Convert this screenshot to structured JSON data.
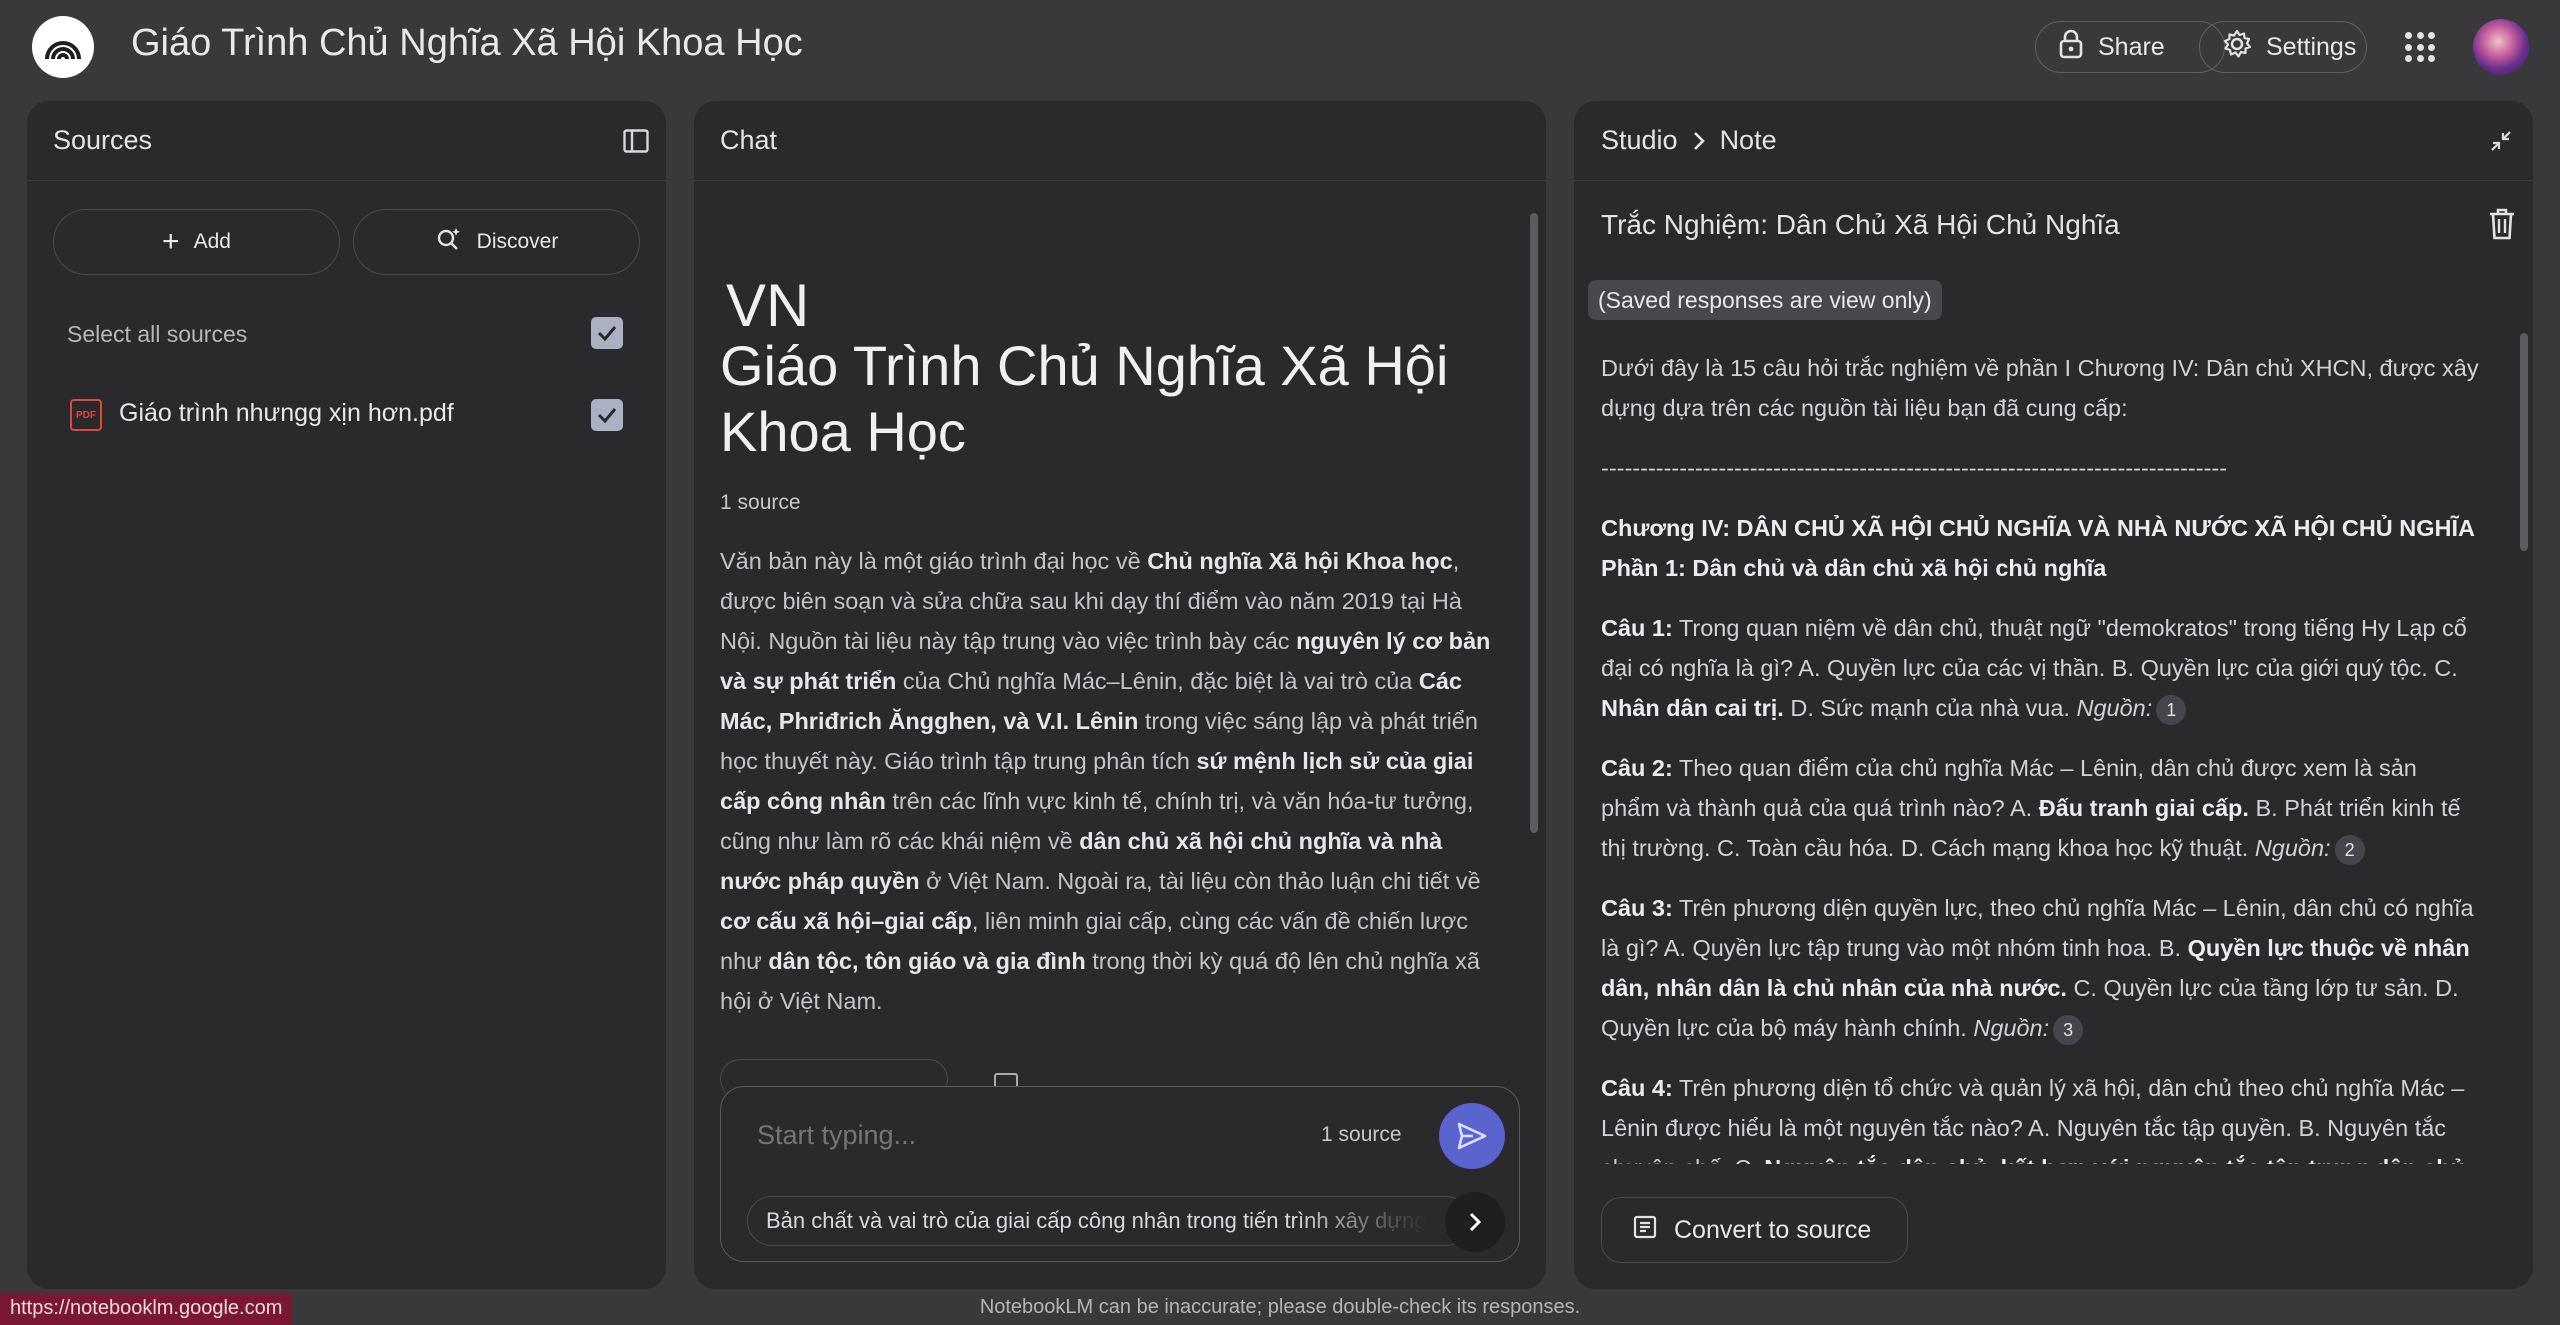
{
  "app": {
    "title": "Giáo Trình Chủ Nghĩa Xã Hội Khoa Học",
    "logo_icon": "notebooklm-logo-icon"
  },
  "header": {
    "share_label": "Share",
    "share_icon": "lock-icon",
    "settings_label": "Settings",
    "settings_icon": "gear-icon",
    "apps_icon": "apps-grid-icon",
    "avatar_icon": "user-avatar"
  },
  "sources": {
    "title": "Sources",
    "collapse_icon": "panel-collapse-icon",
    "add_label": "Add",
    "discover_label": "Discover",
    "select_all_label": "Select all sources",
    "items": [
      {
        "name": "Giáo trình nhưngg xịn hơn.pdf",
        "icon": "pdf-icon",
        "checked": true
      }
    ]
  },
  "chat": {
    "title": "Chat",
    "emoji_tag": "VN",
    "notebook_title": "Giáo Trình Chủ Nghĩa Xã Hội Khoa Học",
    "source_count": "1 source",
    "summary_segments": [
      {
        "t": "Văn bản này là một giáo trình đại học về ",
        "b": false
      },
      {
        "t": "Chủ nghĩa Xã hội Khoa học",
        "b": true
      },
      {
        "t": ", được biên soạn và sửa chữa sau khi dạy thí điểm vào năm 2019 tại Hà Nội. Nguồn tài liệu này tập trung vào việc trình bày các ",
        "b": false
      },
      {
        "t": "nguyên lý cơ bản và sự phát triển",
        "b": true
      },
      {
        "t": " của Chủ nghĩa Mác–Lênin, đặc biệt là vai trò của ",
        "b": false
      },
      {
        "t": "Các Mác, Phriđrich Ăngghen, và V.I. Lênin",
        "b": true
      },
      {
        "t": " trong việc sáng lập và phát triển học thuyết này. Giáo trình tập trung phân tích ",
        "b": false
      },
      {
        "t": "sứ mệnh lịch sử của giai cấp công nhân",
        "b": true
      },
      {
        "t": " trên các lĩnh vực kinh tế, chính trị, và văn hóa-tư tưởng, cũng như làm rõ các khái niệm về ",
        "b": false
      },
      {
        "t": "dân chủ xã hội chủ nghĩa và nhà nước pháp quyền",
        "b": true
      },
      {
        "t": " ở Việt Nam. Ngoài ra, tài liệu còn thảo luận chi tiết về ",
        "b": false
      },
      {
        "t": "cơ cấu xã hội–giai cấp",
        "b": true
      },
      {
        "t": ", liên minh giai cấp, cùng các vấn đề chiến lược như ",
        "b": false
      },
      {
        "t": "dân tộc, tôn giáo và gia đình",
        "b": true
      },
      {
        "t": " trong thời kỳ quá độ lên chủ nghĩa xã hội ở Việt Nam.",
        "b": false
      }
    ],
    "input_placeholder": "Start typing...",
    "input_source_count": "1 source",
    "suggestion": "Bản chất và vai trò của giai cấp công nhân trong tiến trình xây dựng"
  },
  "studio": {
    "breadcrumb_root": "Studio",
    "breadcrumb_current": "Note",
    "collapse_icon": "collapse-content-icon",
    "note_title": "Trắc Nghiệm: Dân Chủ Xã Hội Chủ Nghĩa",
    "delete_icon": "trash-icon",
    "saved_badge": "(Saved responses are view only)",
    "intro": "Dưới đây là 15 câu hỏi trắc nghiệm về phần I Chương IV: Dân chủ XHCN, được xây dựng dựa trên các nguồn tài liệu bạn đã cung cấp:",
    "divider": "--------------------------------------------------------------------------------",
    "chapter_heading": "Chương IV: DÂN CHỦ XÃ HỘI CHỦ NGHĨA VÀ NHÀ NƯỚC XÃ HỘI CHỦ NGHĨA",
    "part_heading": "Phần 1: Dân chủ và dân chủ xã hội chủ nghĩa",
    "questions": [
      {
        "label": "Câu 1:",
        "before": " Trong quan niệm về dân chủ, thuật ngữ \"demokratos\" trong tiếng Hy Lạp cổ đại có nghĩa là gì? A. Quyền lực của các vị thần. B. Quyền lực của giới quý tộc. C. ",
        "answer": "Nhân dân cai trị.",
        "after": " D. Sức mạnh của nhà vua. ",
        "source_label": "Nguồn:",
        "cite": "1"
      },
      {
        "label": "Câu 2:",
        "before": " Theo quan điểm của chủ nghĩa Mác – Lênin, dân chủ được xem là sản phẩm và thành quả của quá trình nào? A. ",
        "answer": "Đấu tranh giai cấp.",
        "after": " B. Phát triển kinh tế thị trường. C. Toàn cầu hóa. D. Cách mạng khoa học kỹ thuật. ",
        "source_label": "Nguồn:",
        "cite": "2"
      },
      {
        "label": "Câu 3:",
        "before": " Trên phương diện quyền lực, theo chủ nghĩa Mác – Lênin, dân chủ có nghĩa là gì? A. Quyền lực tập trung vào một nhóm tinh hoa. B. ",
        "answer": "Quyền lực thuộc về nhân dân, nhân dân là chủ nhân của nhà nước.",
        "after": " C. Quyền lực của tầng lớp tư sản. D. Quyền lực của bộ máy hành chính. ",
        "source_label": "Nguồn:",
        "cite": "3"
      },
      {
        "label": "Câu 4:",
        "before": " Trên phương diện tổ chức và quản lý xã hội, dân chủ theo chủ nghĩa Mác – Lênin được hiểu là một nguyên tắc nào? A. Nguyên tắc tập quyền. B. Nguyên tắc chuyên chế. C. ",
        "answer": "Nguyên tắc dân chủ, kết hợp với nguyên tắc tập trung dân chủ.",
        "after": "",
        "source_label": "",
        "cite": ""
      }
    ],
    "convert_label": "Convert to source",
    "convert_icon": "note-convert-icon"
  },
  "footer": {
    "disclaimer": "NotebookLM can be inaccurate; please double-check its responses.",
    "status_url": "https://notebooklm.google.com"
  }
}
